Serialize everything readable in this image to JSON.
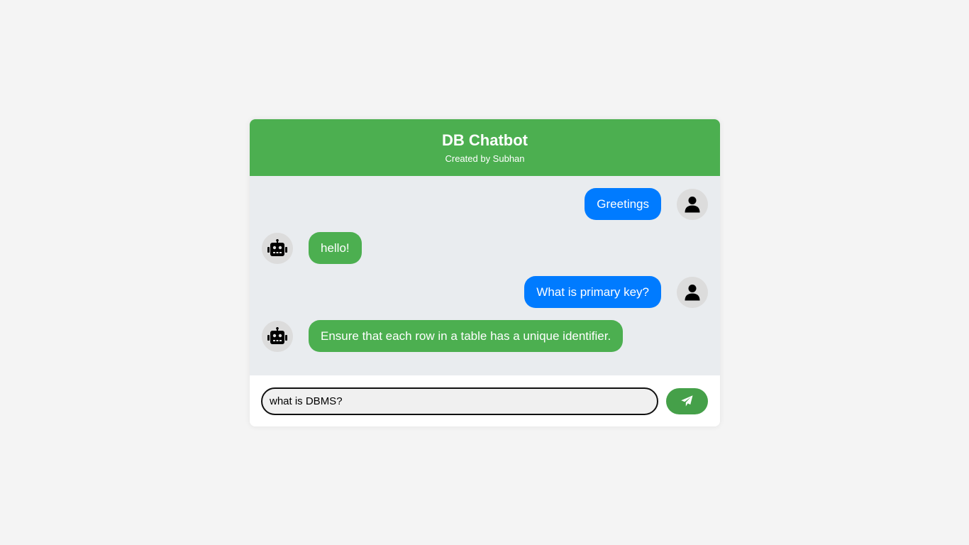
{
  "header": {
    "title": "DB Chatbot",
    "subtitle": "Created by Subhan"
  },
  "messages": [
    {
      "sender": "user",
      "text": "Greetings",
      "avatar_icon": "user-icon"
    },
    {
      "sender": "bot",
      "text": "hello!",
      "avatar_icon": "robot-icon"
    },
    {
      "sender": "user",
      "text": "What is primary key?",
      "avatar_icon": "user-icon"
    },
    {
      "sender": "bot",
      "text": "Ensure that each row in a table has a unique identifier.",
      "avatar_icon": "robot-icon"
    }
  ],
  "input": {
    "value": "what is DBMS?",
    "placeholder": ""
  },
  "send_button": {
    "icon": "paper-plane-icon"
  },
  "colors": {
    "header": "#4caf50",
    "user_bubble": "#007bff",
    "bot_bubble": "#4caf50",
    "send_button": "#45a049",
    "chat_background": "#e9ecef"
  }
}
